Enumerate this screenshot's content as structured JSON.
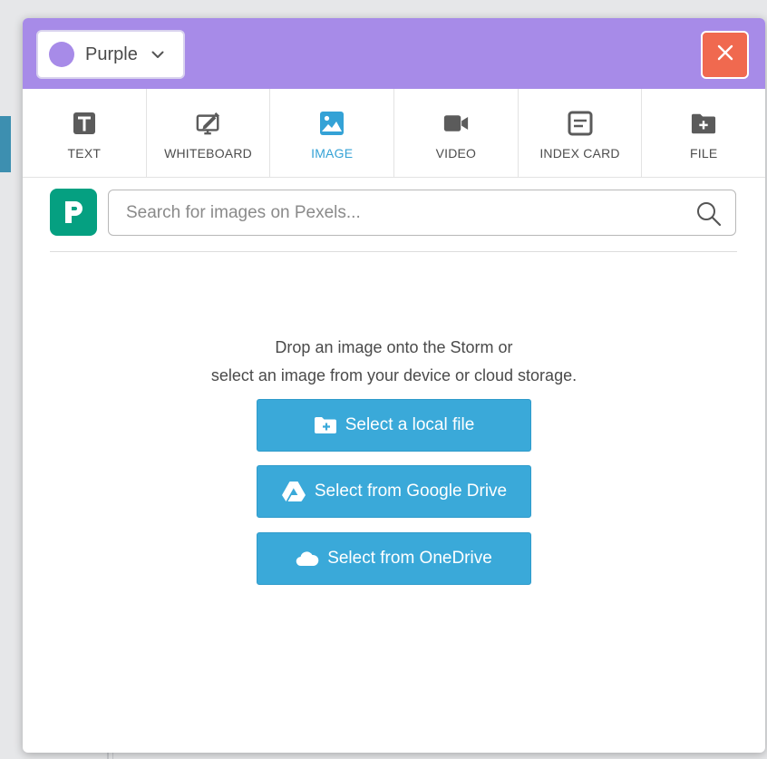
{
  "header": {
    "color_select": {
      "label": "Purple",
      "swatch_color": "#a78be8"
    },
    "background_color": "#a78be8",
    "close_button_color": "#f0694f"
  },
  "tabs": [
    {
      "label": "TEXT",
      "icon": "text-icon",
      "active": false
    },
    {
      "label": "WHITEBOARD",
      "icon": "whiteboard-icon",
      "active": false
    },
    {
      "label": "IMAGE",
      "icon": "image-icon",
      "active": true
    },
    {
      "label": "VIDEO",
      "icon": "video-icon",
      "active": false
    },
    {
      "label": "INDEX CARD",
      "icon": "index-card-icon",
      "active": false
    },
    {
      "label": "FILE",
      "icon": "file-add-icon",
      "active": false
    }
  ],
  "search": {
    "placeholder": "Search for images on Pexels...",
    "value": ""
  },
  "drop_zone": {
    "line1": "Drop an image onto the Storm or",
    "line2": "select an image from your device or cloud storage."
  },
  "buttons": {
    "local": "Select a local file",
    "google_drive": "Select from Google Drive",
    "onedrive": "Select from OneDrive"
  },
  "colors": {
    "accent": "#34a2d6",
    "button": "#3aa9d9",
    "pexels": "#05a081"
  }
}
